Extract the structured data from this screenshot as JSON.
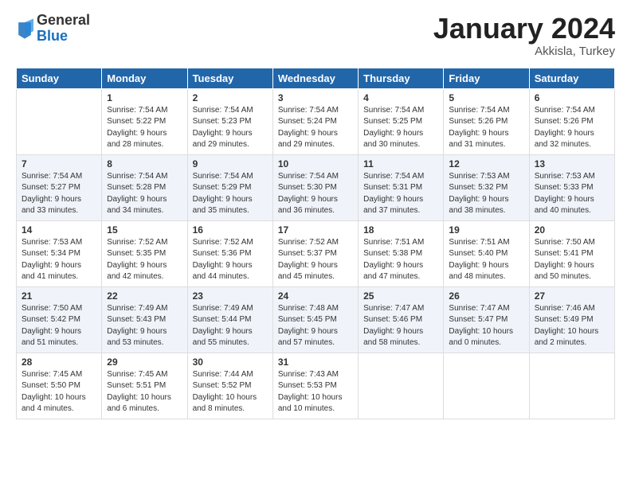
{
  "header": {
    "logo_general": "General",
    "logo_blue": "Blue",
    "month_title": "January 2024",
    "location": "Akkisla, Turkey"
  },
  "days_of_week": [
    "Sunday",
    "Monday",
    "Tuesday",
    "Wednesday",
    "Thursday",
    "Friday",
    "Saturday"
  ],
  "weeks": [
    [
      {
        "day": "",
        "info": ""
      },
      {
        "day": "1",
        "info": "Sunrise: 7:54 AM\nSunset: 5:22 PM\nDaylight: 9 hours\nand 28 minutes."
      },
      {
        "day": "2",
        "info": "Sunrise: 7:54 AM\nSunset: 5:23 PM\nDaylight: 9 hours\nand 29 minutes."
      },
      {
        "day": "3",
        "info": "Sunrise: 7:54 AM\nSunset: 5:24 PM\nDaylight: 9 hours\nand 29 minutes."
      },
      {
        "day": "4",
        "info": "Sunrise: 7:54 AM\nSunset: 5:25 PM\nDaylight: 9 hours\nand 30 minutes."
      },
      {
        "day": "5",
        "info": "Sunrise: 7:54 AM\nSunset: 5:26 PM\nDaylight: 9 hours\nand 31 minutes."
      },
      {
        "day": "6",
        "info": "Sunrise: 7:54 AM\nSunset: 5:26 PM\nDaylight: 9 hours\nand 32 minutes."
      }
    ],
    [
      {
        "day": "7",
        "info": "Sunrise: 7:54 AM\nSunset: 5:27 PM\nDaylight: 9 hours\nand 33 minutes."
      },
      {
        "day": "8",
        "info": "Sunrise: 7:54 AM\nSunset: 5:28 PM\nDaylight: 9 hours\nand 34 minutes."
      },
      {
        "day": "9",
        "info": "Sunrise: 7:54 AM\nSunset: 5:29 PM\nDaylight: 9 hours\nand 35 minutes."
      },
      {
        "day": "10",
        "info": "Sunrise: 7:54 AM\nSunset: 5:30 PM\nDaylight: 9 hours\nand 36 minutes."
      },
      {
        "day": "11",
        "info": "Sunrise: 7:54 AM\nSunset: 5:31 PM\nDaylight: 9 hours\nand 37 minutes."
      },
      {
        "day": "12",
        "info": "Sunrise: 7:53 AM\nSunset: 5:32 PM\nDaylight: 9 hours\nand 38 minutes."
      },
      {
        "day": "13",
        "info": "Sunrise: 7:53 AM\nSunset: 5:33 PM\nDaylight: 9 hours\nand 40 minutes."
      }
    ],
    [
      {
        "day": "14",
        "info": "Sunrise: 7:53 AM\nSunset: 5:34 PM\nDaylight: 9 hours\nand 41 minutes."
      },
      {
        "day": "15",
        "info": "Sunrise: 7:52 AM\nSunset: 5:35 PM\nDaylight: 9 hours\nand 42 minutes."
      },
      {
        "day": "16",
        "info": "Sunrise: 7:52 AM\nSunset: 5:36 PM\nDaylight: 9 hours\nand 44 minutes."
      },
      {
        "day": "17",
        "info": "Sunrise: 7:52 AM\nSunset: 5:37 PM\nDaylight: 9 hours\nand 45 minutes."
      },
      {
        "day": "18",
        "info": "Sunrise: 7:51 AM\nSunset: 5:38 PM\nDaylight: 9 hours\nand 47 minutes."
      },
      {
        "day": "19",
        "info": "Sunrise: 7:51 AM\nSunset: 5:40 PM\nDaylight: 9 hours\nand 48 minutes."
      },
      {
        "day": "20",
        "info": "Sunrise: 7:50 AM\nSunset: 5:41 PM\nDaylight: 9 hours\nand 50 minutes."
      }
    ],
    [
      {
        "day": "21",
        "info": "Sunrise: 7:50 AM\nSunset: 5:42 PM\nDaylight: 9 hours\nand 51 minutes."
      },
      {
        "day": "22",
        "info": "Sunrise: 7:49 AM\nSunset: 5:43 PM\nDaylight: 9 hours\nand 53 minutes."
      },
      {
        "day": "23",
        "info": "Sunrise: 7:49 AM\nSunset: 5:44 PM\nDaylight: 9 hours\nand 55 minutes."
      },
      {
        "day": "24",
        "info": "Sunrise: 7:48 AM\nSunset: 5:45 PM\nDaylight: 9 hours\nand 57 minutes."
      },
      {
        "day": "25",
        "info": "Sunrise: 7:47 AM\nSunset: 5:46 PM\nDaylight: 9 hours\nand 58 minutes."
      },
      {
        "day": "26",
        "info": "Sunrise: 7:47 AM\nSunset: 5:47 PM\nDaylight: 10 hours\nand 0 minutes."
      },
      {
        "day": "27",
        "info": "Sunrise: 7:46 AM\nSunset: 5:49 PM\nDaylight: 10 hours\nand 2 minutes."
      }
    ],
    [
      {
        "day": "28",
        "info": "Sunrise: 7:45 AM\nSunset: 5:50 PM\nDaylight: 10 hours\nand 4 minutes."
      },
      {
        "day": "29",
        "info": "Sunrise: 7:45 AM\nSunset: 5:51 PM\nDaylight: 10 hours\nand 6 minutes."
      },
      {
        "day": "30",
        "info": "Sunrise: 7:44 AM\nSunset: 5:52 PM\nDaylight: 10 hours\nand 8 minutes."
      },
      {
        "day": "31",
        "info": "Sunrise: 7:43 AM\nSunset: 5:53 PM\nDaylight: 10 hours\nand 10 minutes."
      },
      {
        "day": "",
        "info": ""
      },
      {
        "day": "",
        "info": ""
      },
      {
        "day": "",
        "info": ""
      }
    ]
  ]
}
